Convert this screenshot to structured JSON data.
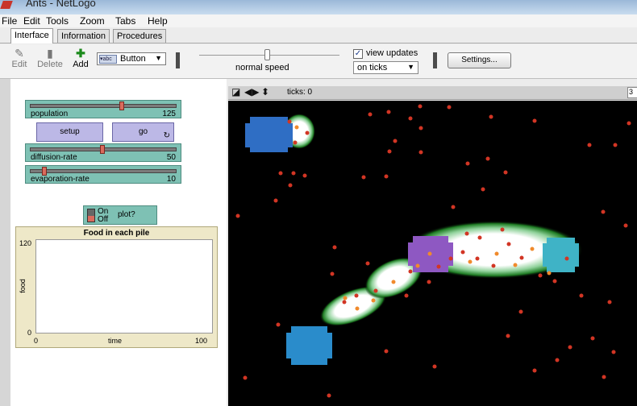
{
  "window": {
    "title": "Ants - NetLogo"
  },
  "menu": [
    "File",
    "Edit",
    "Tools",
    "Zoom",
    "Tabs",
    "Help"
  ],
  "tabs": [
    "Interface",
    "Information",
    "Procedures"
  ],
  "toolbar": {
    "edit_label": "Edit",
    "delete_label": "Delete",
    "add_label": "Add",
    "widget_type": "Button",
    "speed_label": "normal speed",
    "view_updates_label": "view updates",
    "view_updates_checked": true,
    "update_mode": "on ticks",
    "settings_label": "Settings..."
  },
  "controls": {
    "population": {
      "label": "population",
      "value": "125",
      "level": 0.66
    },
    "setup_label": "setup",
    "go_label": "go",
    "diffusion": {
      "label": "diffusion-rate",
      "value": "50",
      "level": 0.5
    },
    "evaporation": {
      "label": "evaporation-rate",
      "value": "10",
      "level": 0.1
    },
    "plot_switch": {
      "on": "On",
      "off": "Off",
      "label": "plot?"
    }
  },
  "plot": {
    "title": "Food in each pile",
    "ylabel": "food",
    "xlabel": "time",
    "ymax": "120",
    "ymin": "0",
    "xmin": "0",
    "xmax": "100"
  },
  "view": {
    "ticks_label": "ticks: 0",
    "tick_box": "3"
  }
}
